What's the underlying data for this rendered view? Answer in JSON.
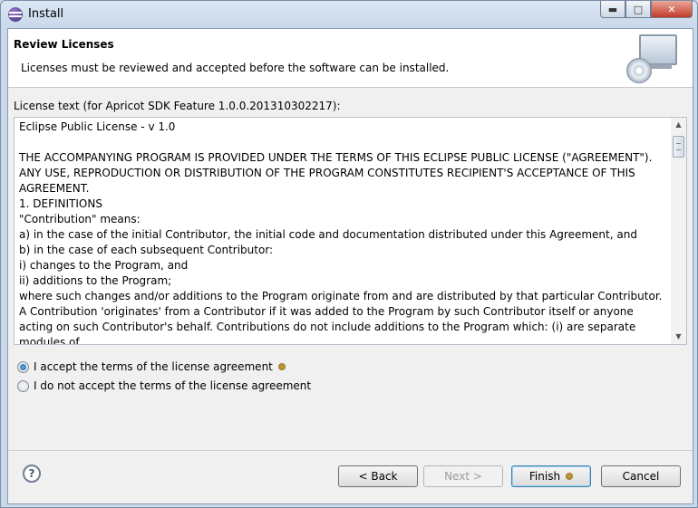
{
  "window": {
    "title": "Install"
  },
  "header": {
    "title": "Review Licenses",
    "description": "Licenses must be reviewed and accepted before the software can be installed.",
    "image_icon": "install-monitor-cd-icon"
  },
  "license": {
    "label": "License text (for Apricot SDK Feature 1.0.0.201310302217):",
    "text": "Eclipse Public License - v 1.0\n\nTHE ACCOMPANYING PROGRAM IS PROVIDED UNDER THE TERMS OF THIS ECLIPSE PUBLIC LICENSE (\"AGREEMENT\"). ANY USE, REPRODUCTION OR DISTRIBUTION OF THE PROGRAM CONSTITUTES RECIPIENT'S ACCEPTANCE OF THIS AGREEMENT.\n1. DEFINITIONS\n\"Contribution\" means:\na) in the case of the initial Contributor, the initial code and documentation distributed under this Agreement, and\nb) in the case of each subsequent Contributor:\ni) changes to the Program, and\nii) additions to the Program;\nwhere such changes and/or additions to the Program originate from and are distributed by that particular Contributor. A Contribution 'originates' from a Contributor if it was added to the Program by such Contributor itself or anyone acting on such Contributor's behalf. Contributions do not include additions to the Program which: (i) are separate modules of"
  },
  "options": {
    "accept": "I accept the terms of the license agreement",
    "decline": "I do not accept the terms of the license agreement",
    "selected": "accept"
  },
  "buttons": {
    "back": "< Back",
    "next": "Next >",
    "finish": "Finish",
    "cancel": "Cancel",
    "help": "?"
  },
  "colors": {
    "titlebar": "#dbe6f3",
    "close_button": "#c43b28",
    "dialog_bg": "#f0f0f0"
  }
}
